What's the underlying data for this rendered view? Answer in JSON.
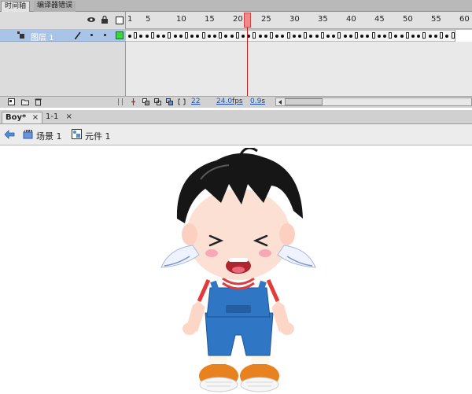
{
  "panel_tabs": [
    "时间轴",
    "编译器错误"
  ],
  "timeline": {
    "ruler_numbers": [
      "1",
      "5",
      "10",
      "15",
      "20",
      "25",
      "30",
      "35",
      "40",
      "45",
      "50",
      "55",
      "60"
    ],
    "layer_name": "图层 1",
    "current_frame": "22",
    "fps": "24.0",
    "fps_unit": "fps",
    "time": "0.9",
    "time_unit": "s"
  },
  "doc_tabs": [
    {
      "label": "Boy*",
      "close": "×"
    },
    {
      "label": "1-1",
      "close": "×"
    }
  ],
  "breadcrumb": {
    "scene": "场景 1",
    "symbol": "元件 1"
  },
  "colors": {
    "layer_highlight": "#a9c4e6",
    "playhead": "#c42020",
    "keyframe_box": "#39d839",
    "link": "#1d55b6"
  }
}
